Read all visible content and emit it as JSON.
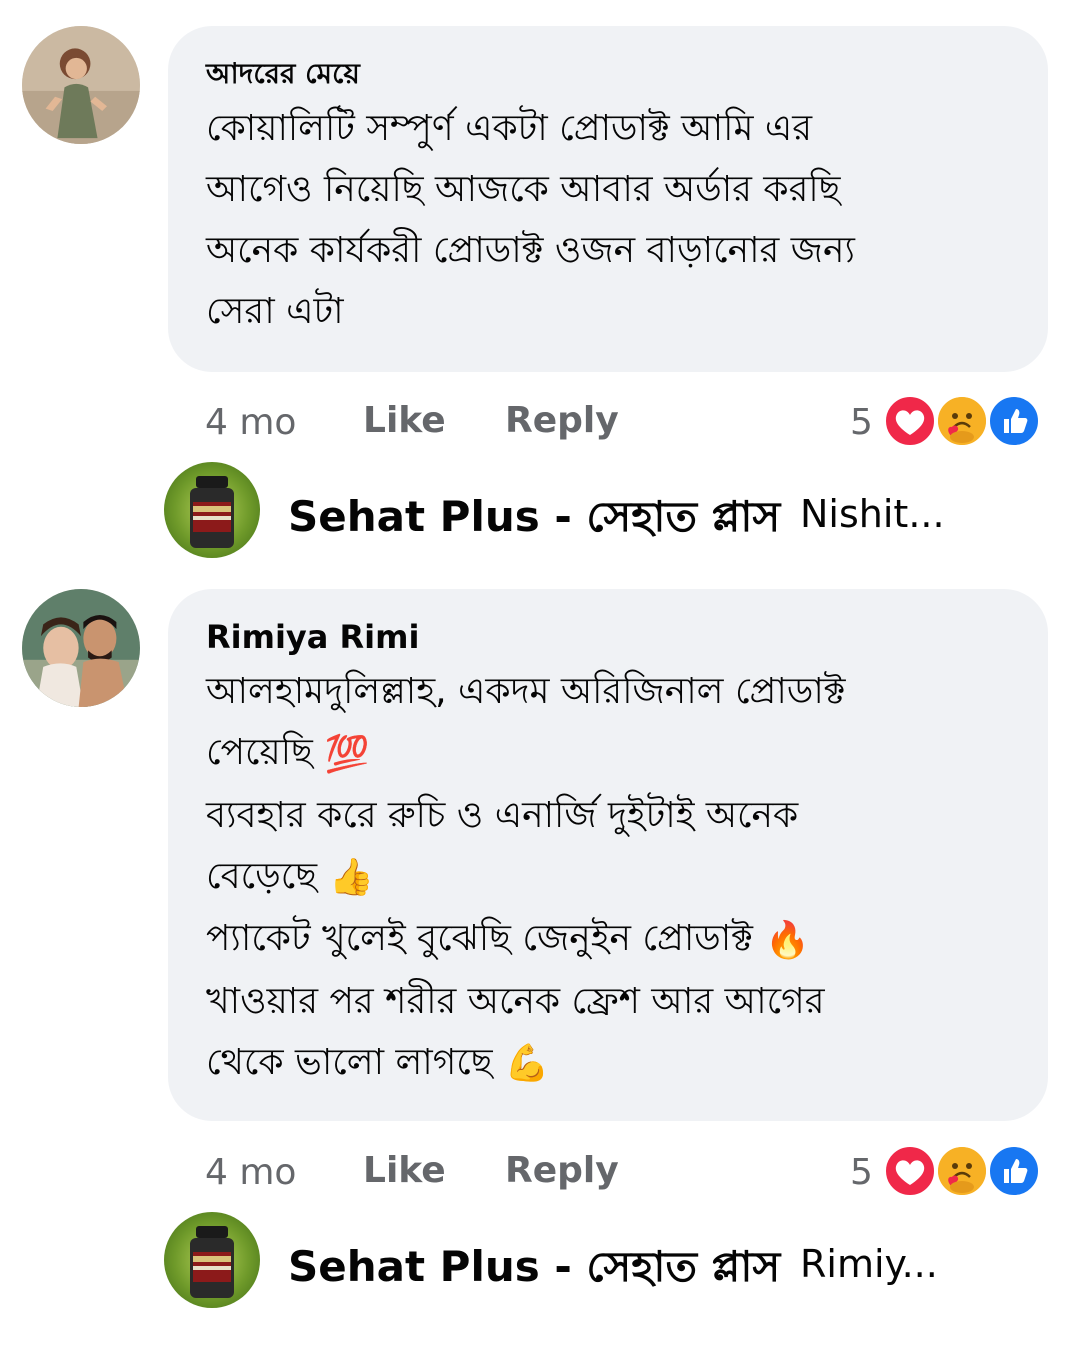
{
  "comments": [
    {
      "author": "আদরের মেয়ে",
      "lines": [
        "কোয়ালিটি সম্পুর্ণ একটা প্রোডাক্ট আমি এর",
        "আগেও নিয়েছি আজকে আবার অর্ডার করছি",
        "অনেক কার্যকরী প্রোডাক্ট ওজন বাড়ানোর জন্য",
        "সেরা এটা"
      ],
      "time": "4 mo",
      "like_label": "Like",
      "reply_label": "Reply",
      "reaction_count": "5",
      "reactions": [
        "love-icon",
        "care-icon",
        "like-icon"
      ],
      "reply": {
        "page_name": "Sehat Plus - সেহাত প্লাস",
        "preview": "Nishit..."
      }
    },
    {
      "author": "Rimiya Rimi",
      "lines": [
        "আলহামদুলিল্লাহ, একদম অরিজিনাল প্রোডাক্ট",
        "পেয়েছি",
        "ব্যবহার করে রুচি ও এনার্জি দুইটাই অনেক",
        "বেড়েছে",
        "প্যাকেট খুলেই বুঝেছি জেনুইন প্রোডাক্ট",
        "খাওয়ার পর শরীর অনেক ফ্রেশ আর আগের",
        "থেকে ভালো লাগছে"
      ],
      "line_emojis": [
        "",
        "💯",
        "",
        "👍",
        "🔥",
        "",
        "💪"
      ],
      "time": "4 mo",
      "like_label": "Like",
      "reply_label": "Reply",
      "reaction_count": "5",
      "reactions": [
        "love-icon",
        "care-icon",
        "like-icon"
      ],
      "reply": {
        "page_name": "Sehat Plus - সেহাত প্লাস",
        "preview": "Rimiy..."
      }
    }
  ],
  "colors": {
    "bubble": "#f0f2f5",
    "meta_text": "#65676b",
    "love": "#f02849",
    "like": "#1877f2",
    "care": "#f7b125"
  }
}
